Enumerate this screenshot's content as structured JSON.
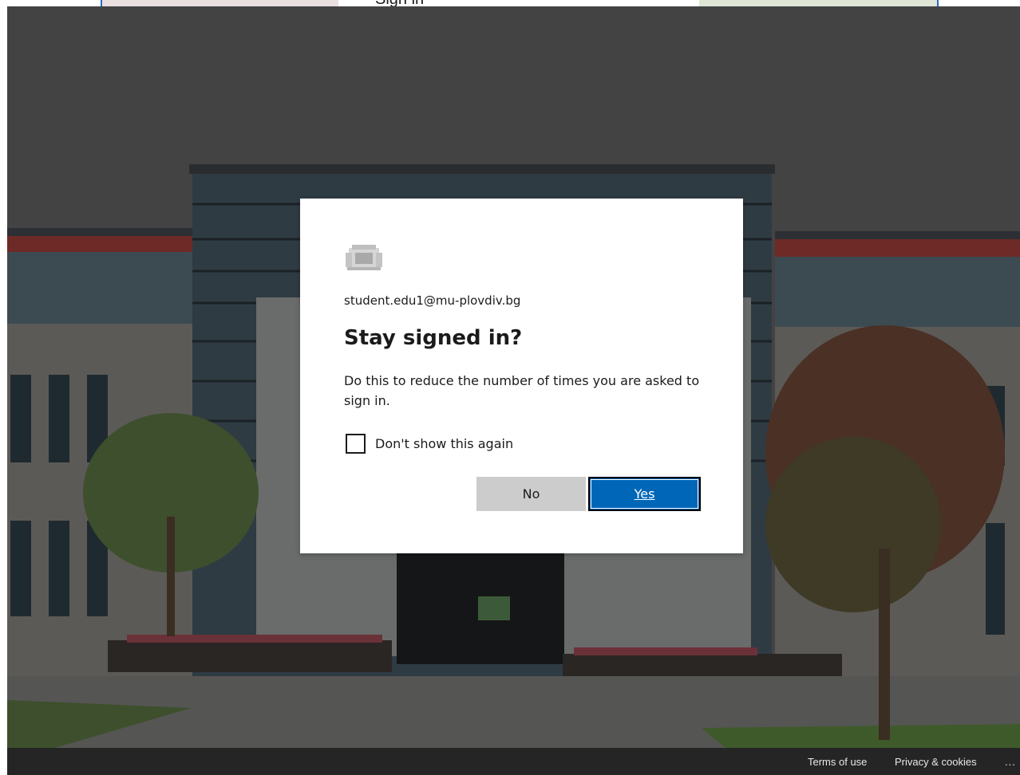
{
  "top_strip": {
    "peek_text": "Sign in"
  },
  "dialog": {
    "logo_icon": "university-crest-icon",
    "account_email": "student.edu1@mu-plovdiv.bg",
    "title": "Stay signed in?",
    "description": "Do this to reduce the number of times you are asked to sign in.",
    "checkbox_label": "Don't show this again",
    "checkbox_checked": false,
    "no_label": "No",
    "yes_label": "Yes"
  },
  "footer": {
    "terms_label": "Terms of use",
    "privacy_label": "Privacy & cookies",
    "more_label": "..."
  },
  "colors": {
    "primary_button": "#0067b8",
    "secondary_button": "#cccccc",
    "text": "#1b1b1b"
  }
}
